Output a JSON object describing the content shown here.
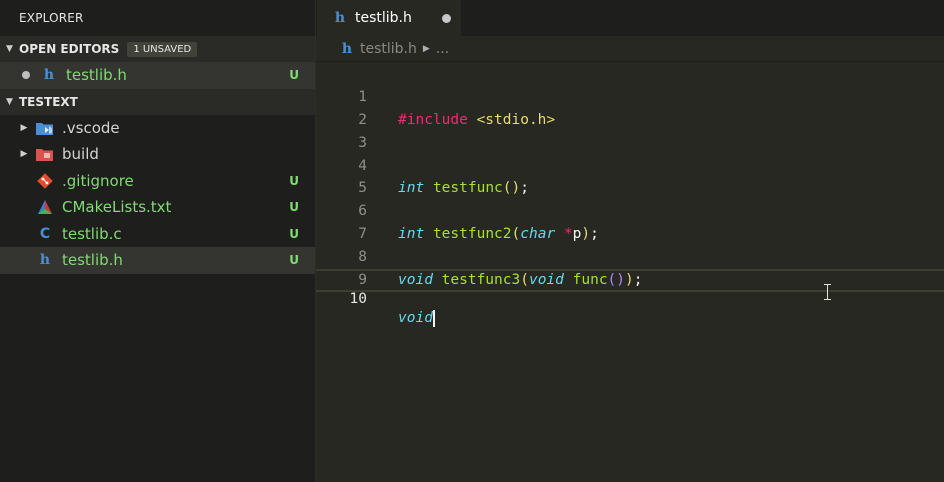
{
  "sidebar": {
    "title": "EXPLORER",
    "open_editors": {
      "header": "OPEN EDITORS",
      "badge": "1 UNSAVED",
      "items": [
        {
          "name": "testlib.h",
          "icon": "h",
          "status": "U"
        }
      ]
    },
    "workspace": {
      "header": "TESTEXT",
      "items": [
        {
          "name": ".vscode",
          "type": "folder",
          "icon": "vscode-folder-icon"
        },
        {
          "name": "build",
          "type": "folder",
          "icon": "build-folder-icon"
        },
        {
          "name": ".gitignore",
          "icon": "git-icon",
          "status": "U"
        },
        {
          "name": "CMakeLists.txt",
          "icon": "cmake-icon",
          "status": "U"
        },
        {
          "name": "testlib.c",
          "icon": "C",
          "status": "U"
        },
        {
          "name": "testlib.h",
          "icon": "h",
          "status": "U"
        }
      ]
    }
  },
  "editor": {
    "tab": {
      "name": "testlib.h",
      "icon": "h"
    },
    "breadcrumb": {
      "file": "testlib.h",
      "rest": "..."
    },
    "lines": [
      {
        "n": "1"
      },
      {
        "n": "2"
      },
      {
        "n": "3"
      },
      {
        "n": "4"
      },
      {
        "n": "5"
      },
      {
        "n": "6"
      },
      {
        "n": "7"
      },
      {
        "n": "8"
      },
      {
        "n": "9"
      },
      {
        "n": "10"
      }
    ],
    "code": {
      "l1": {
        "pp": "#include",
        "sp": " ",
        "hdr": "<stdio.h>"
      },
      "l4": {
        "kw": "int",
        "sp": " ",
        "fn": "testfunc",
        "p1": "(",
        "p2": ")",
        "semi": ";"
      },
      "l6": {
        "kw": "int",
        "sp": " ",
        "fn": "testfunc2",
        "p1": "(",
        "kw2": "char",
        "sp2": " ",
        "op": "*",
        "arg": "p",
        "p2": ")",
        "semi": ";"
      },
      "l8": {
        "kw": "void",
        "sp": " ",
        "fn": "testfunc3",
        "p1": "(",
        "kw2": "void",
        "sp2": " ",
        "fn2": "func",
        "p3": "(",
        "p4": ")",
        "p2": ")",
        "semi": ";"
      },
      "l10": {
        "kw": "void"
      }
    },
    "colors": {
      "background": "#272822",
      "keyword": "#66d9ef",
      "function": "#a6e22e",
      "string": "#e6db74",
      "preprocessor": "#f92672"
    }
  }
}
